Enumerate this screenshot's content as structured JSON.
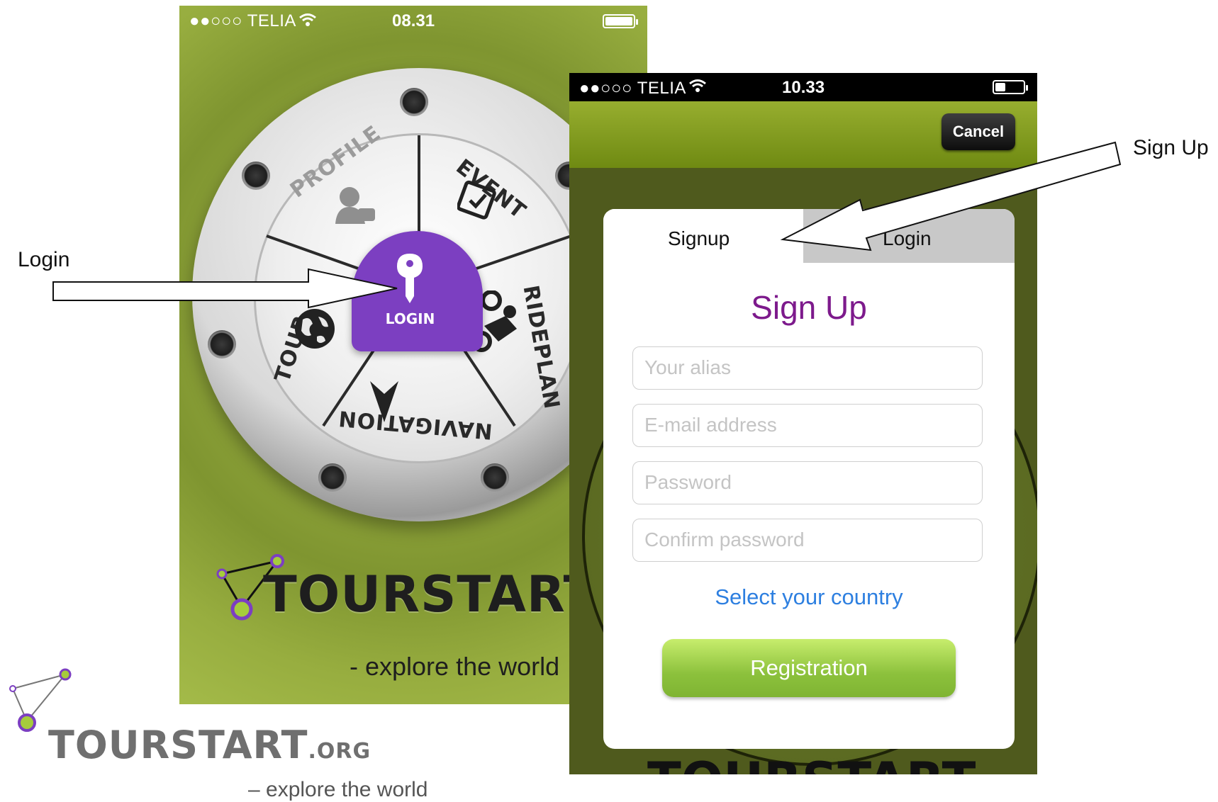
{
  "phone_home": {
    "status": {
      "carrier": "●●○○○ TELIA",
      "time": "08.31"
    },
    "menu": {
      "profile": "PROFILE",
      "event": "EVENT",
      "rideplan": "RIDEPLAN",
      "navigation": "NAVIGATION",
      "tour": "TOUR",
      "login": "LOGIN"
    },
    "brand": "TOURSTART",
    "tagline": "- explore the world",
    "icons": [
      "wifi-icon",
      "battery-icon",
      "profile-icon",
      "calendar-icon",
      "key-icon",
      "globe-icon",
      "arrow-icon",
      "motorcycle-icon"
    ]
  },
  "phone_signup": {
    "status": {
      "carrier": "●●○○○ TELIA",
      "time": "10.33"
    },
    "cancel_label": "Cancel",
    "tabs": {
      "signup": "Signup",
      "login": "Login"
    },
    "title": "Sign Up",
    "fields": {
      "alias": "Your alias",
      "email": "E-mail address",
      "password": "Password",
      "confirm": "Confirm password"
    },
    "country_link": "Select your country",
    "register_label": "Registration",
    "brand_partial": "TOURSTART"
  },
  "logo": {
    "brand": "TOURSTART",
    "suffix": ".ORG",
    "tagline": "– explore the world"
  },
  "annotations": {
    "login": "Login",
    "signup": "Sign Up"
  },
  "colors": {
    "purple": "#7c3fc1",
    "olive": "#8ea33a",
    "title_purple": "#7d1a8c",
    "link_blue": "#2d7fe0",
    "button_green": "#8cc13c"
  }
}
